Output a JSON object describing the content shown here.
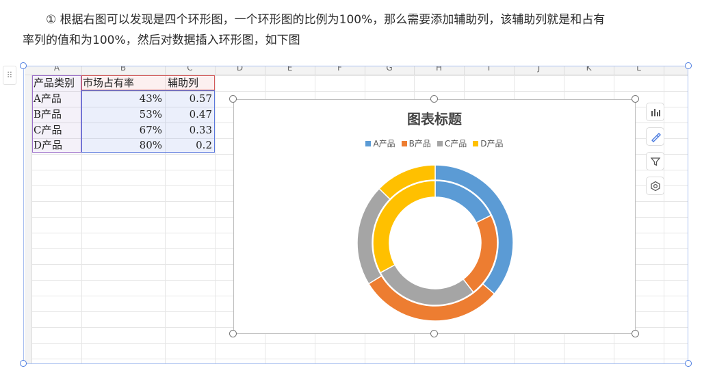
{
  "paragraph": {
    "marker": "①",
    "line1": "根据右图可以发现是四个环形图，一个环形图的比例为100%，那么需要添加辅助列，该辅助列就是和占有",
    "line2": "率列的值和为100%，然后对数据插入环形图，如下图"
  },
  "sheet": {
    "columns": [
      "A",
      "B",
      "C",
      "D",
      "E",
      "F",
      "G",
      "H",
      "I",
      "J",
      "K",
      "L"
    ],
    "headers": [
      "产品类别",
      "市场占有率",
      "辅助列"
    ],
    "rows": [
      {
        "category": "A产品",
        "share": "43%",
        "aux": "0.57"
      },
      {
        "category": "B产品",
        "share": "53%",
        "aux": "0.47"
      },
      {
        "category": "C产品",
        "share": "67%",
        "aux": "0.33"
      },
      {
        "category": "D产品",
        "share": "80%",
        "aux": "0.2"
      }
    ]
  },
  "chart_data": {
    "type": "doughnut",
    "title": "图表标题",
    "legend_position": "top",
    "categories": [
      "A产品",
      "B产品",
      "C产品",
      "D产品"
    ],
    "colors": [
      "#5b9bd5",
      "#ed7d31",
      "#a5a5a5",
      "#ffc000"
    ],
    "series": [
      {
        "values": [
          0.43,
          0.53,
          0.67,
          0.8
        ]
      },
      {
        "values": [
          0.57,
          0.47,
          0.33,
          0.2
        ]
      }
    ]
  },
  "tools": [
    "chart-elements-icon",
    "chart-style-icon",
    "chart-filter-icon",
    "chart-settings-icon"
  ]
}
